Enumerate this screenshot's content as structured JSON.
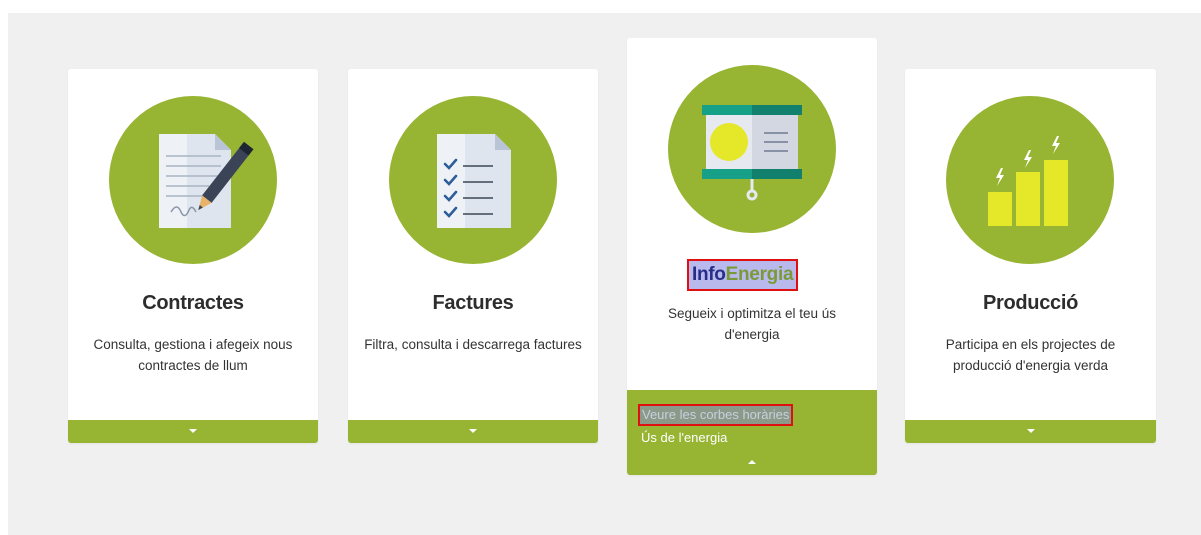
{
  "cards": [
    {
      "title": "Contractes",
      "description": "Consulta, gestiona i afegeix nous contractes de llum",
      "icon": "contract-document-pen-icon"
    },
    {
      "title": "Factures",
      "description": "Filtra, consulta i descarrega factures",
      "icon": "invoice-checklist-icon"
    },
    {
      "title_part1": "Info",
      "title_part2": "Energia",
      "description": "Segueix i optimitza el teu ús d'energia",
      "icon": "presentation-board-icon",
      "links": [
        "Veure les corbes horàries",
        "Ús de l'energia"
      ]
    },
    {
      "title": "Producció",
      "description": "Participa en els projectes de producció d'energia verda",
      "icon": "bar-chart-lightning-icon"
    }
  ],
  "colors": {
    "accent": "#97b432",
    "panel_bg": "#f0f0f0",
    "highlight_outline": "#e01010",
    "highlight_bg": "#b9b9ee"
  }
}
